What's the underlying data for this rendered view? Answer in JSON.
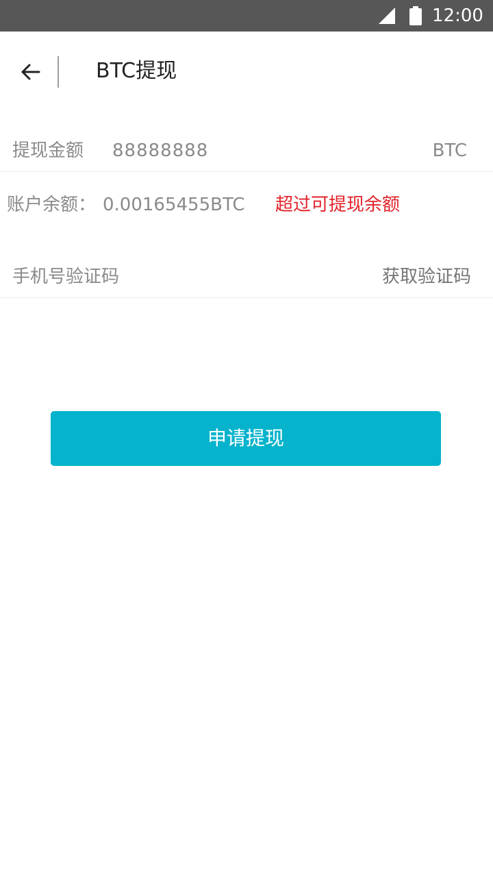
{
  "status_bar": {
    "time": "12:00",
    "icons": [
      "signal-icon",
      "battery-icon"
    ]
  },
  "header": {
    "back_icon": "arrow-left-icon",
    "title": "BTC提现"
  },
  "form": {
    "amount_label": "提现金额",
    "amount_value": "88888888",
    "amount_unit": "BTC",
    "balance_label": "账户余额：",
    "balance_value": "0.00165455BTC",
    "balance_error": "超过可提现余额",
    "code_placeholder": "手机号验证码",
    "get_code_label": "获取验证码"
  },
  "actions": {
    "submit_label": "申请提现"
  },
  "colors": {
    "status_bar": "#575757",
    "accent": "#06b3cc",
    "error": "#e2232a",
    "text_muted": "#8a8a8a"
  }
}
